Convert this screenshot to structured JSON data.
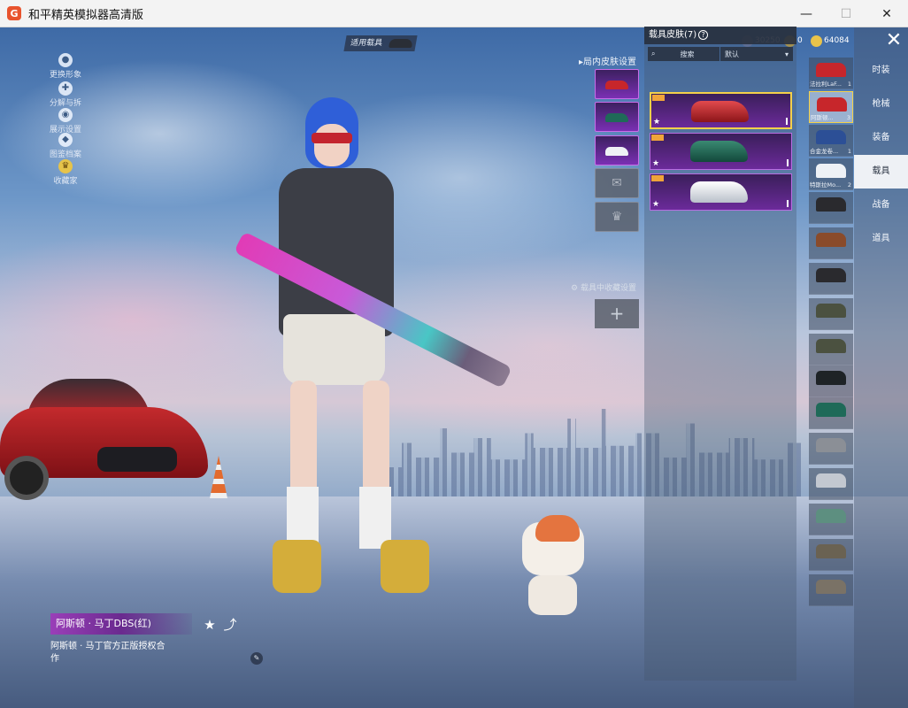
{
  "window": {
    "title": "和平精英模拟器高清版",
    "minimize": "—",
    "maximize": "☐",
    "close": "✕"
  },
  "side_menu": [
    {
      "label": "更换形象",
      "icon": "person"
    },
    {
      "label": "分解与拆解",
      "icon": "puzzle"
    },
    {
      "label": "展示设置",
      "icon": "eye"
    },
    {
      "label": "图鉴档案",
      "icon": "badge"
    },
    {
      "label": "收藏家",
      "icon": "crown"
    }
  ],
  "apply_tag": "适用载具",
  "currency": [
    {
      "value": "30250",
      "color": "#6b7aa8"
    },
    {
      "value": "0",
      "color": "#d6b040"
    },
    {
      "value": "64084",
      "color": "#e8c34a"
    }
  ],
  "skin_settings": {
    "label": "局内皮肤设置",
    "slot_label": "载具中收藏设置",
    "plus": "+"
  },
  "vehicle_panel": {
    "title": "载具皮肤(7)",
    "help": "?",
    "search": "搜索",
    "sort": "默认",
    "cards": [
      {
        "car_color": "#c7262b"
      },
      {
        "car_color": "#1f6a58"
      },
      {
        "car_color": "#e9edf3"
      }
    ]
  },
  "vehicle_list": [
    {
      "label": "法拉利LaF...",
      "num": "1",
      "color": "#c7262b"
    },
    {
      "label": "阿斯顿...",
      "num": "3",
      "color": "#c7262b"
    },
    {
      "label": "合金龙卷...",
      "num": "1",
      "color": "#2c4f96"
    },
    {
      "label": "特斯拉Mo...",
      "num": "2",
      "color": "#eef1f5"
    },
    {
      "label": "",
      "num": "",
      "color": "#2a2a2e"
    },
    {
      "label": "",
      "num": "",
      "color": "#8a4b2a"
    },
    {
      "label": "",
      "num": "",
      "color": "#2a2a2e"
    },
    {
      "label": "",
      "num": "",
      "color": "#4b5140"
    },
    {
      "label": "",
      "num": "",
      "color": "#4b5140"
    },
    {
      "label": "",
      "num": "",
      "color": "#1e2326"
    },
    {
      "label": "",
      "num": "",
      "color": "#1f6a58"
    },
    {
      "label": "",
      "num": "",
      "color": "#8b8f96"
    },
    {
      "label": "",
      "num": "",
      "color": "#c3c8d0"
    },
    {
      "label": "",
      "num": "",
      "color": "#5d8f80"
    },
    {
      "label": "",
      "num": "",
      "color": "#6a6252"
    },
    {
      "label": "",
      "num": "",
      "color": "#7a7266"
    }
  ],
  "nav": [
    "时装",
    "枪械",
    "装备",
    "载具",
    "战备",
    "道具"
  ],
  "selected_item": {
    "name": "阿斯顿 · 马丁DBS(红)",
    "desc": "阿斯顿 · 马丁官方正版授权合作"
  }
}
